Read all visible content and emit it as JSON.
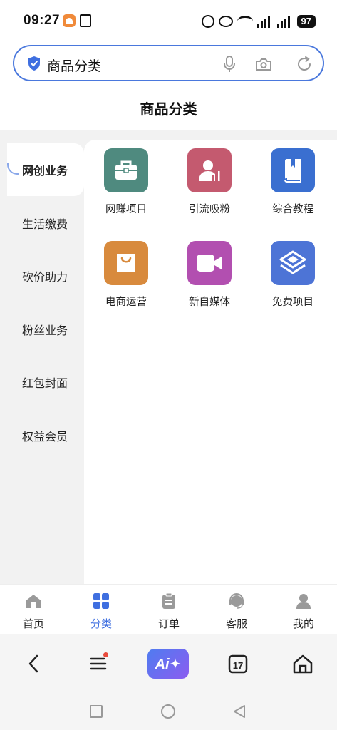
{
  "status_bar": {
    "time": "09:27",
    "battery": "97"
  },
  "search": {
    "text": "商品分类"
  },
  "page_title": "商品分类",
  "sidebar": {
    "items": [
      {
        "label": "网创业务",
        "active": true
      },
      {
        "label": "生活缴费",
        "active": false
      },
      {
        "label": "砍价助力",
        "active": false
      },
      {
        "label": "粉丝业务",
        "active": false
      },
      {
        "label": "红包封面",
        "active": false
      },
      {
        "label": "权益会员",
        "active": false
      }
    ]
  },
  "categories": [
    {
      "label": "网赚项目",
      "icon": "briefcase-icon",
      "color": "#4f8a7f"
    },
    {
      "label": "引流吸粉",
      "icon": "user-growth-icon",
      "color": "#c45a6f"
    },
    {
      "label": "综合教程",
      "icon": "book-icon",
      "color": "#3a6fd0"
    },
    {
      "label": "电商运营",
      "icon": "shopping-bag-icon",
      "color": "#d88a3d"
    },
    {
      "label": "新自媒体",
      "icon": "video-camera-icon",
      "color": "#b24fb0"
    },
    {
      "label": "免费项目",
      "icon": "layers-icon",
      "color": "#4d74d6"
    }
  ],
  "bottom_nav": {
    "items": [
      {
        "label": "首页",
        "icon": "home-icon"
      },
      {
        "label": "分类",
        "icon": "grid-icon",
        "active": true
      },
      {
        "label": "订单",
        "icon": "clipboard-icon"
      },
      {
        "label": "客服",
        "icon": "headset-icon"
      },
      {
        "label": "我的",
        "icon": "person-icon"
      }
    ]
  },
  "browser_toolbar": {
    "ai_label": "Ai✦",
    "calendar_day": "17"
  },
  "colors": {
    "accent": "#3f6fe0",
    "search_border": "#4a78dd"
  }
}
